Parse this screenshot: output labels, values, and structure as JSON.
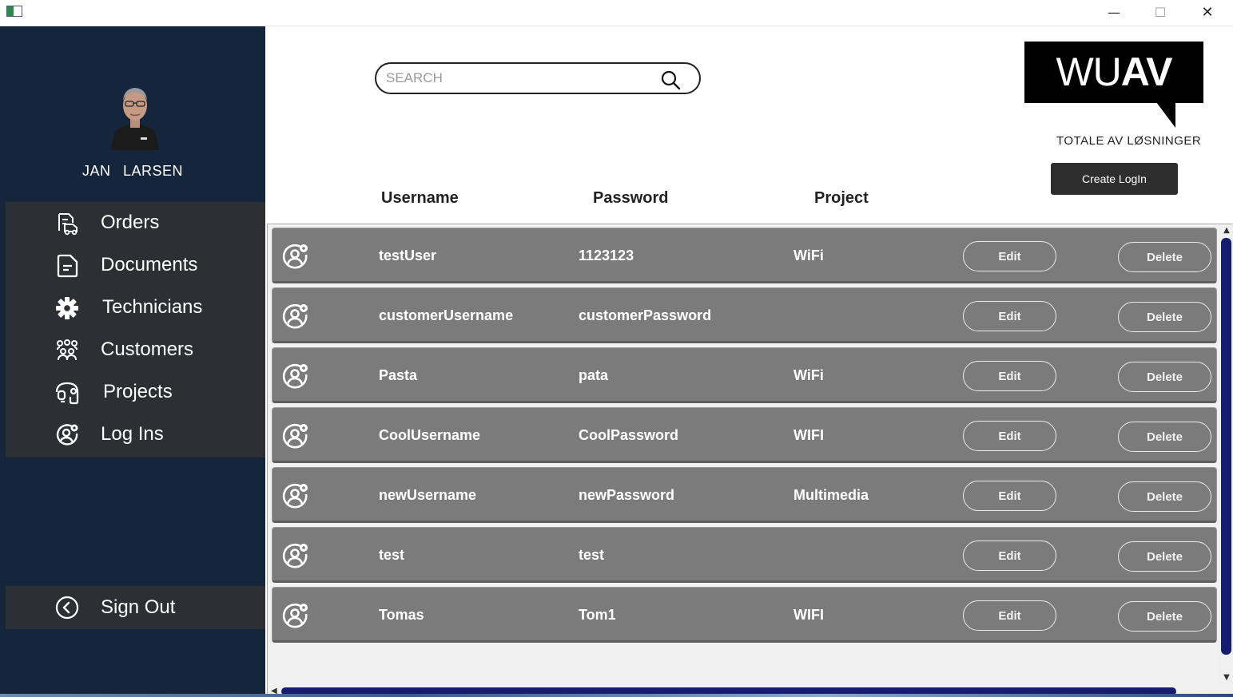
{
  "window": {
    "minimize_glyph": "—",
    "maximize_glyph": "☐",
    "close_glyph": "✕"
  },
  "sidebar": {
    "user": {
      "first_name": "JAN",
      "last_name": "LARSEN",
      "full_name": "JAN LARSEN"
    },
    "items": [
      {
        "label": "Orders",
        "icon": "truck-document-icon"
      },
      {
        "label": "Documents",
        "icon": "document-icon"
      },
      {
        "label": "Technicians",
        "icon": "gear-icon"
      },
      {
        "label": "Customers",
        "icon": "group-icon"
      },
      {
        "label": "Projects",
        "icon": "project-icon"
      },
      {
        "label": "Log Ins",
        "icon": "user-settings-icon"
      }
    ],
    "sign_out": {
      "label": "Sign Out",
      "icon": "chevron-left-circle-icon"
    }
  },
  "search": {
    "placeholder": "SEARCH",
    "value": ""
  },
  "logo": {
    "word_thin": "WU",
    "word_bold": "AV",
    "tagline": "TOTALE AV LØSNINGER"
  },
  "create_button": {
    "label": "Create LogIn"
  },
  "table": {
    "columns": [
      "Username",
      "Password",
      "Project"
    ],
    "rows": [
      {
        "username": "testUser",
        "password": "1123123",
        "project": "WiFi"
      },
      {
        "username": "customerUsername",
        "password": "customerPassword",
        "project": ""
      },
      {
        "username": "Pasta",
        "password": "pata",
        "project": "WiFi"
      },
      {
        "username": "CoolUsername",
        "password": "CoolPassword",
        "project": "WIFI"
      },
      {
        "username": "newUsername",
        "password": "newPassword",
        "project": "Multimedia"
      },
      {
        "username": "test",
        "password": "test",
        "project": ""
      },
      {
        "username": "Tomas",
        "password": "Tom1",
        "project": "WIFI"
      }
    ],
    "edit_label": "Edit",
    "delete_label": "Delete"
  },
  "colors": {
    "sidebar_bg": "#15263c",
    "nav_bg": "#2c2f33",
    "row_bg": "#7b7b7b",
    "scrollbar_thumb": "#161d6f",
    "button_dark": "#2e2e2e"
  }
}
